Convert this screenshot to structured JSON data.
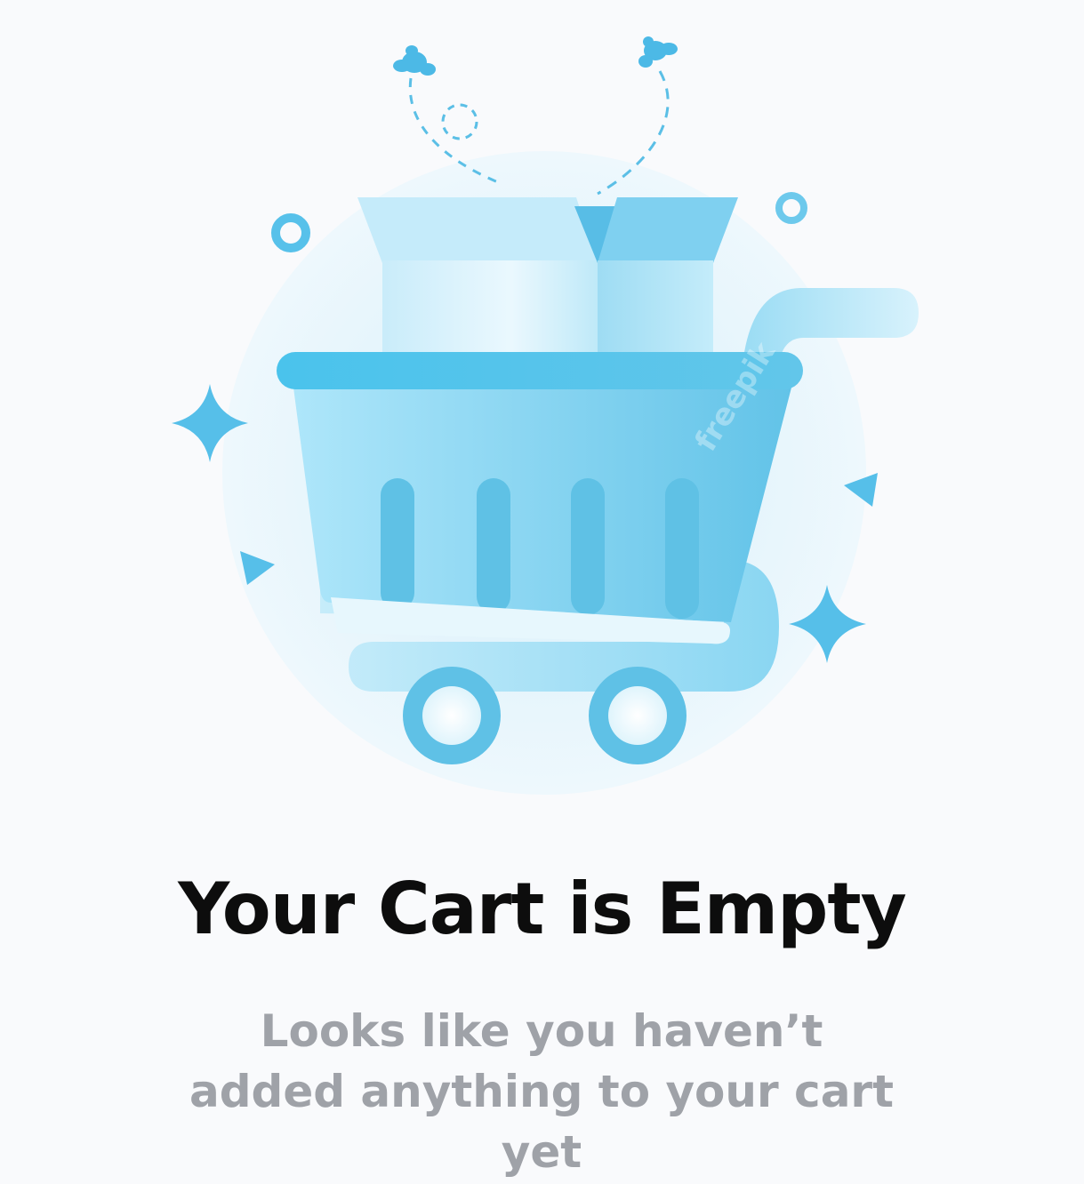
{
  "empty_state": {
    "title": "Your Cart is Empty",
    "subtitle": "Looks like you haven’t added anything to your cart yet",
    "illustration": "shopping-cart-with-boxes-icon",
    "watermark": "freepik"
  },
  "colors": {
    "background": "#f9fafc",
    "title": "#0d0d0d",
    "subtitle": "#9fa2a8",
    "accent": "#4ec3ea",
    "accent_light": "#a8e4f7",
    "glow": "#dff2fb"
  }
}
